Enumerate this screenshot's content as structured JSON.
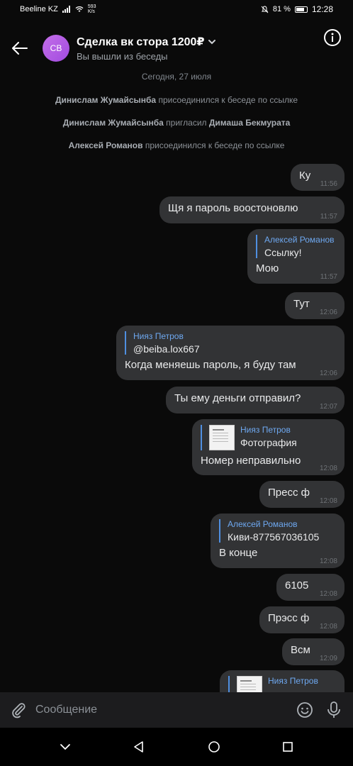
{
  "status_bar": {
    "carrier": "Beeline KZ",
    "speed_value": "593",
    "speed_unit": "K/s",
    "battery": "81 %",
    "battery_level": 0.81,
    "time": "12:28"
  },
  "header": {
    "avatar_initials": "СВ",
    "title": "Сделка вк стора 1200₽",
    "subtitle": "Вы вышли из беседы"
  },
  "chat": {
    "date": "Сегодня, 27 июля",
    "system": [
      {
        "actor": "Динислам Жумайсынба",
        "action": " присоединился к беседе по ссылке",
        "target": ""
      },
      {
        "actor": "Динислам Жумайсынба",
        "action": " пригласил ",
        "target": "Димаша Бекмурата"
      },
      {
        "actor": "Алексей Романов",
        "action": " присоединился к беседе по ссылке",
        "target": ""
      }
    ],
    "messages": [
      {
        "text": "Ку",
        "time": "11:56"
      },
      {
        "text": "Щя я пароль воостоновлю",
        "time": "11:57"
      },
      {
        "reply_author": "Алексей Романов",
        "reply_text": "Ссылку!",
        "text": "Мою",
        "time": "11:57"
      },
      {
        "text": "Тут",
        "time": "12:06"
      },
      {
        "reply_author": "Нияз Петров",
        "reply_text": "@beiba.lox667",
        "text": "Когда меняешь пароль, я буду там",
        "time": "12:06"
      },
      {
        "text": "Ты ему деньги отправил?",
        "time": "12:07"
      },
      {
        "reply_author": "Нияз Петров",
        "reply_text": "Фотография",
        "text": "Номер неправильно",
        "time": "12:08"
      },
      {
        "text": "Пресс ф",
        "time": "12:08"
      },
      {
        "reply_author": "Алексей Романов",
        "reply_text": "Киви-877567036105",
        "text": "В конце",
        "time": "12:08"
      },
      {
        "text": "6105",
        "time": "12:08"
      },
      {
        "text": "Прэсс ф",
        "time": "12:08"
      },
      {
        "text": "Всм",
        "time": "12:09"
      },
      {
        "reply_author": "Нияз Петров",
        "reply_text": "",
        "text": "",
        "time": ""
      }
    ]
  },
  "composer": {
    "placeholder": "Сообщение"
  },
  "icons": {
    "back": "arrow-left-icon",
    "info": "info-icon",
    "attach": "paperclip-icon",
    "emoji": "emoji-icon",
    "mic": "microphone-icon",
    "nav_down": "chevron-down-icon",
    "nav_back": "triangle-back-icon",
    "nav_home": "circle-home-icon",
    "nav_recents": "square-recents-icon"
  },
  "colors": {
    "accent": "#6ea8f0",
    "bubble": "#323335",
    "avatar": "#b65de6"
  }
}
